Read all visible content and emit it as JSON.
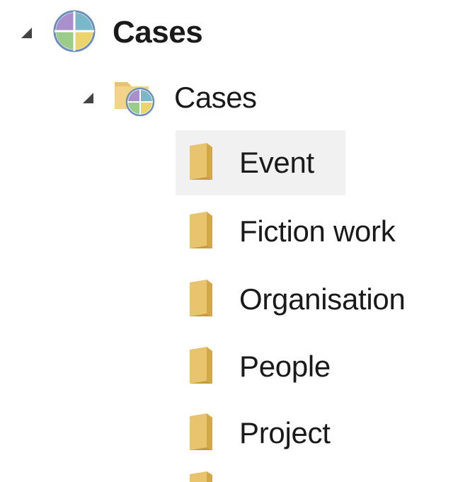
{
  "tree": {
    "root": {
      "label": "Cases",
      "icon": "case-classification-icon",
      "expanded": true
    },
    "child": {
      "label": "Cases",
      "icon": "case-folder-icon",
      "expanded": true
    },
    "items": [
      {
        "label": "Event",
        "icon": "folder-icon",
        "selected": true
      },
      {
        "label": "Fiction work",
        "icon": "folder-icon",
        "selected": false
      },
      {
        "label": "Organisation",
        "icon": "folder-icon",
        "selected": false
      },
      {
        "label": "People",
        "icon": "folder-icon",
        "selected": false
      },
      {
        "label": "Project",
        "icon": "folder-icon",
        "selected": false
      }
    ]
  },
  "colors": {
    "folder": "#e8c46f",
    "folder_dark": "#d4a84a",
    "selection": "#f1f1f1",
    "pie_purple": "#a98fcb",
    "pie_green": "#9ccc8a",
    "pie_yellow": "#ead46b",
    "pie_teal": "#7ab8c9"
  }
}
